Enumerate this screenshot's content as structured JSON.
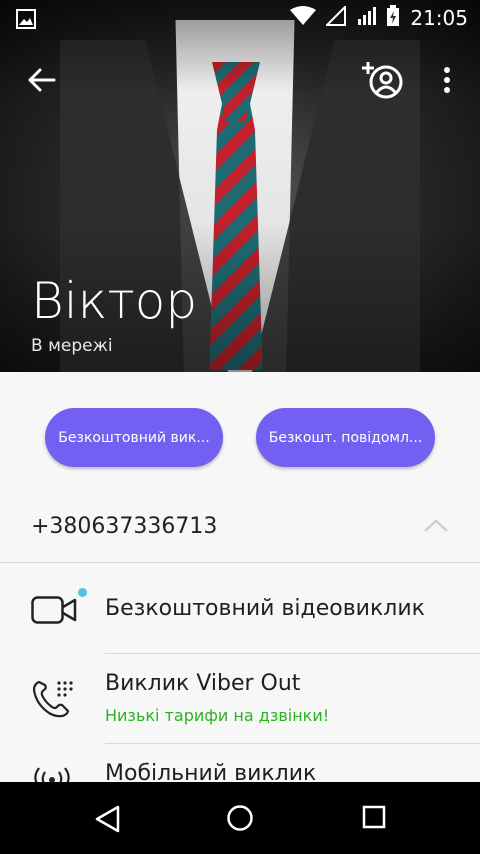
{
  "statusbar": {
    "time": "21:05"
  },
  "contact": {
    "name": "Віктор",
    "presence": "В мережі"
  },
  "actions": {
    "free_call_label": "Безкоштовний вик...",
    "free_message_label": "Безкошт. повідомл..."
  },
  "phone_number": "+380637336713",
  "options": [
    {
      "title": "Безкоштовний відеовиклик",
      "icon": "video-camera-icon"
    },
    {
      "title": "Виклик Viber Out",
      "subtitle": "Низькі тарифи на дзвінки!",
      "icon": "phone-dial-icon"
    },
    {
      "title": "Мобільний виклик",
      "icon": "mobile-signal-icon"
    }
  ],
  "colors": {
    "accent": "#7360f2",
    "promo_green": "#2bb31f",
    "badge_dot": "#4ac6d8"
  }
}
